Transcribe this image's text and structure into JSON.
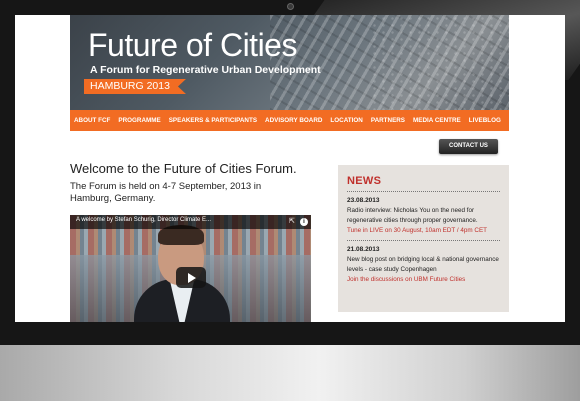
{
  "banner": {
    "title": "Future of Cities",
    "subtitle": "A Forum for Regenerative Urban Development",
    "tag": "HAMBURG 2013"
  },
  "nav": {
    "items": [
      "ABOUT FCF",
      "PROGRAMME",
      "SPEAKERS & PARTICIPANTS",
      "ADVISORY BOARD",
      "LOCATION",
      "PARTNERS",
      "MEDIA CENTRE",
      "LIVEBLOG"
    ]
  },
  "contact": {
    "label": "CONTACT US"
  },
  "main": {
    "welcome": "Welcome to the Future of Cities Forum.",
    "intro": "The Forum is held on 4-7 September, 2013 in Hamburg, Germany."
  },
  "video": {
    "title": "A welcome by Stefan Schurig, Director Climate E...",
    "icons": [
      "share-icon",
      "info-icon",
      "play-icon"
    ]
  },
  "news": {
    "title": "NEWS",
    "items": [
      {
        "date": "23.08.2013",
        "text": "Radio interview: Nicholas You on the need for regenerative cities through proper governance.",
        "link": "Tune in LIVE on 30 August, 10am EDT / 4pm CET"
      },
      {
        "date": "21.08.2013",
        "text": "New blog post on bridging local & national governance levels - case study Copenhagen",
        "link": "Join the discussions on UBM Future Cities"
      }
    ]
  },
  "colors": {
    "accent": "#f26c23",
    "news_red": "#c0302c",
    "news_bg": "#e6e2de"
  }
}
